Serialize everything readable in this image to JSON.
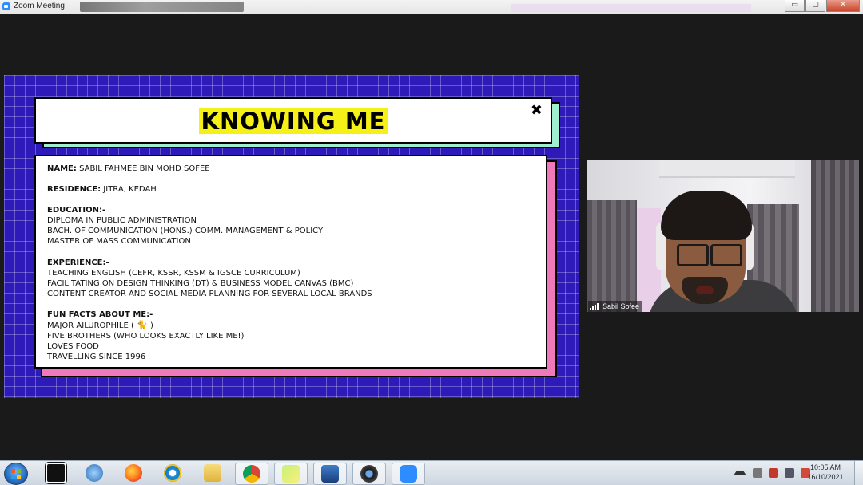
{
  "window": {
    "title": "Zoom Meeting",
    "controls": {
      "minimize": "▭",
      "maximize": "▢",
      "close": "✕"
    }
  },
  "slide": {
    "title": "KNOWING ME",
    "close_glyph": "✖",
    "name_label": "NAME:",
    "name_value": " SABIL FAHMEE BIN MOHD SOFEE",
    "residence_label": "RESIDENCE:",
    "residence_value": " JITRA, KEDAH",
    "education_label": "EDUCATION:-",
    "education": [
      "DIPLOMA IN PUBLIC ADMINISTRATION",
      "BACH. OF COMMUNICATION (HONS.) COMM. MANAGEMENT & POLICY",
      "MASTER OF MASS COMMUNICATION"
    ],
    "experience_label": "EXPERIENCE:-",
    "experience": [
      "TEACHING ENGLISH (CEFR, KSSR, KSSM & IGSCE CURRICULUM)",
      "FACILITATING ON DESIGN THINKING (DT) & BUSINESS MODEL CANVAS (BMC)",
      "CONTENT CREATOR AND SOCIAL MEDIA PLANNING FOR SEVERAL LOCAL BRANDS"
    ],
    "funfacts_label": "FUN FACTS ABOUT ME:-",
    "funfact_1_prefix": "MAJOR AILUROPHILE ( ",
    "funfact_1_emoji": "🐈",
    "funfact_1_suffix": " )",
    "funfacts_rest": [
      "FIVE BROTHERS (WHO LOOKS EXACTLY LIKE ME!)",
      "LOVES FOOD",
      "TRAVELLING SINCE 1996"
    ],
    "colors": {
      "grid_bg": "#2d1ab8",
      "title_highlight": "#f5f016",
      "title_shadow": "#9ef0cf",
      "content_shadow": "#f07ab9"
    }
  },
  "participant": {
    "name": "Sabil Sofee",
    "mic_icon": "signal-bars-icon"
  },
  "taskbar": {
    "clock_time": "10:05 AM",
    "clock_date": "16/10/2021"
  }
}
